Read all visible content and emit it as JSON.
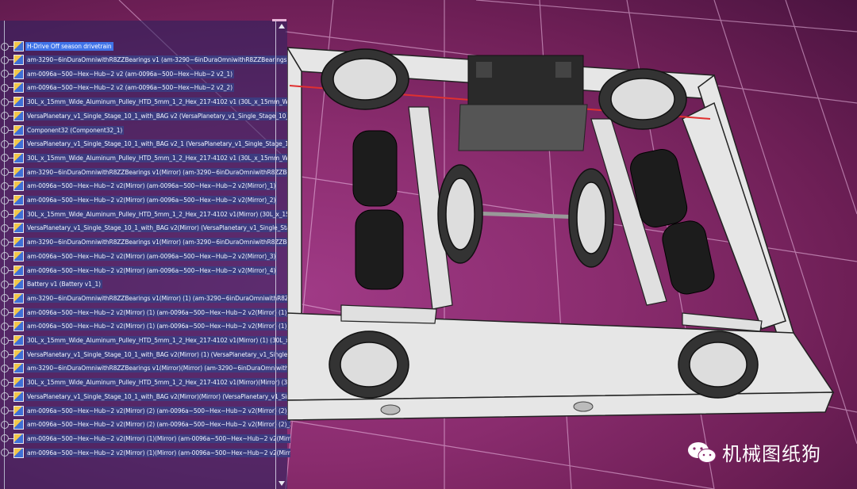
{
  "tree": {
    "root_label": "H-Drive Off season drivetrain",
    "items": [
      "am-3290~6inDuraOmniwithR8ZZBearings v1 (am-3290~6inDuraOmniwithR8ZZBearings v1_",
      "am-0096a~500~Hex~Hub~2 v2 (am-0096a~500~Hex~Hub~2 v2_1)",
      "am-0096a~500~Hex~Hub~2 v2 (am-0096a~500~Hex~Hub~2 v2_2)",
      "30L_x_15mm_Wide_Aluminum_Pulley_HTD_5mm_1_2_Hex_217-4102 v1 (30L_x_15mm_W",
      "VersaPlanetary_v1_Single_Stage_10_1_with_BAG v2 (VersaPlanetary_v1_Single_Stage_10_1_",
      "Component32 (Component32_1)",
      "VersaPlanetary_v1_Single_Stage_10_1_with_BAG v2_1 (VersaPlanetary_v1_Single_Stage_10_",
      "30L_x_15mm_Wide_Aluminum_Pulley_HTD_5mm_1_2_Hex_217-4102 v1 (30L_x_15mm_Wi",
      "am-3290~6inDuraOmniwithR8ZZBearings v1(Mirror) (am-3290~6inDuraOmniwithR8ZZBear",
      "am-0096a~500~Hex~Hub~2 v2(Mirror) (am-0096a~500~Hex~Hub~2 v2(Mirror)_1)",
      "am-0096a~500~Hex~Hub~2 v2(Mirror) (am-0096a~500~Hex~Hub~2 v2(Mirror)_2)",
      "30L_x_15mm_Wide_Aluminum_Pulley_HTD_5mm_1_2_Hex_217-4102 v1(Mirror) (30L_x_15",
      "VersaPlanetary_v1_Single_Stage_10_1_with_BAG v2(Mirror) (VersaPlanetary_v1_Single_Stag",
      "am-3290~6inDuraOmniwithR8ZZBearings v1(Mirror) (am-3290~6inDuraOmniwithR8ZZBear",
      "am-0096a~500~Hex~Hub~2 v2(Mirror) (am-0096a~500~Hex~Hub~2 v2(Mirror)_3)",
      "am-0096a~500~Hex~Hub~2 v2(Mirror) (am-0096a~500~Hex~Hub~2 v2(Mirror)_4)",
      "Battery v1 (Battery v1_1)",
      "am-3290~6inDuraOmniwithR8ZZBearings v1(Mirror) (1) (am-3290~6inDuraOmniwithR8ZZB",
      "am-0096a~500~Hex~Hub~2 v2(Mirror) (1) (am-0096a~500~Hex~Hub~2 v2(Mirror) (1)_1",
      "am-0096a~500~Hex~Hub~2 v2(Mirror) (1) (am-0096a~500~Hex~Hub~2 v2(Mirror) (1)_2",
      "30L_x_15mm_Wide_Aluminum_Pulley_HTD_5mm_1_2_Hex_217-4102 v1(Mirror) (1) (30L_x",
      "VersaPlanetary_v1_Single_Stage_10_1_with_BAG v2(Mirror) (1) (VersaPlanetary_v1_Single_S",
      "am-3290~6inDuraOmniwithR8ZZBearings v1(Mirror)(Mirror) (am-3290~6inDuraOmniwithR8",
      "30L_x_15mm_Wide_Aluminum_Pulley_HTD_5mm_1_2_Hex_217-4102 v1(Mirror)(Mirror) (3",
      "VersaPlanetary_v1_Single_Stage_10_1_with_BAG v2(Mirror)(Mirror) (VersaPlanetary_v1_Sing",
      "am-0096a~500~Hex~Hub~2 v2(Mirror) (2) (am-0096a~500~Hex~Hub~2 v2(Mirror) (2)_1",
      "am-0096a~500~Hex~Hub~2 v2(Mirror) (2) (am-0096a~500~Hex~Hub~2 v2(Mirror) (2)_2",
      "am-0096a~500~Hex~Hub~2 v2(Mirror) (1)(Mirror) (am-0096a~500~Hex~Hub~2 v2(Mirror",
      "am-0096a~500~Hex~Hub~2 v2(Mirror) (1)(Mirror) (am-0096a~500~Hex~Hub~2 v2(Mirror"
    ]
  },
  "watermark": {
    "text": "机械图纸狗",
    "icon": "wechat-icon"
  },
  "colors": {
    "background": "#8a2c6e",
    "tree_label_bg": "#3c3c80",
    "selected_bg": "#3f73e8",
    "frame": "#e8e8e8",
    "red_line": "#e03030"
  }
}
